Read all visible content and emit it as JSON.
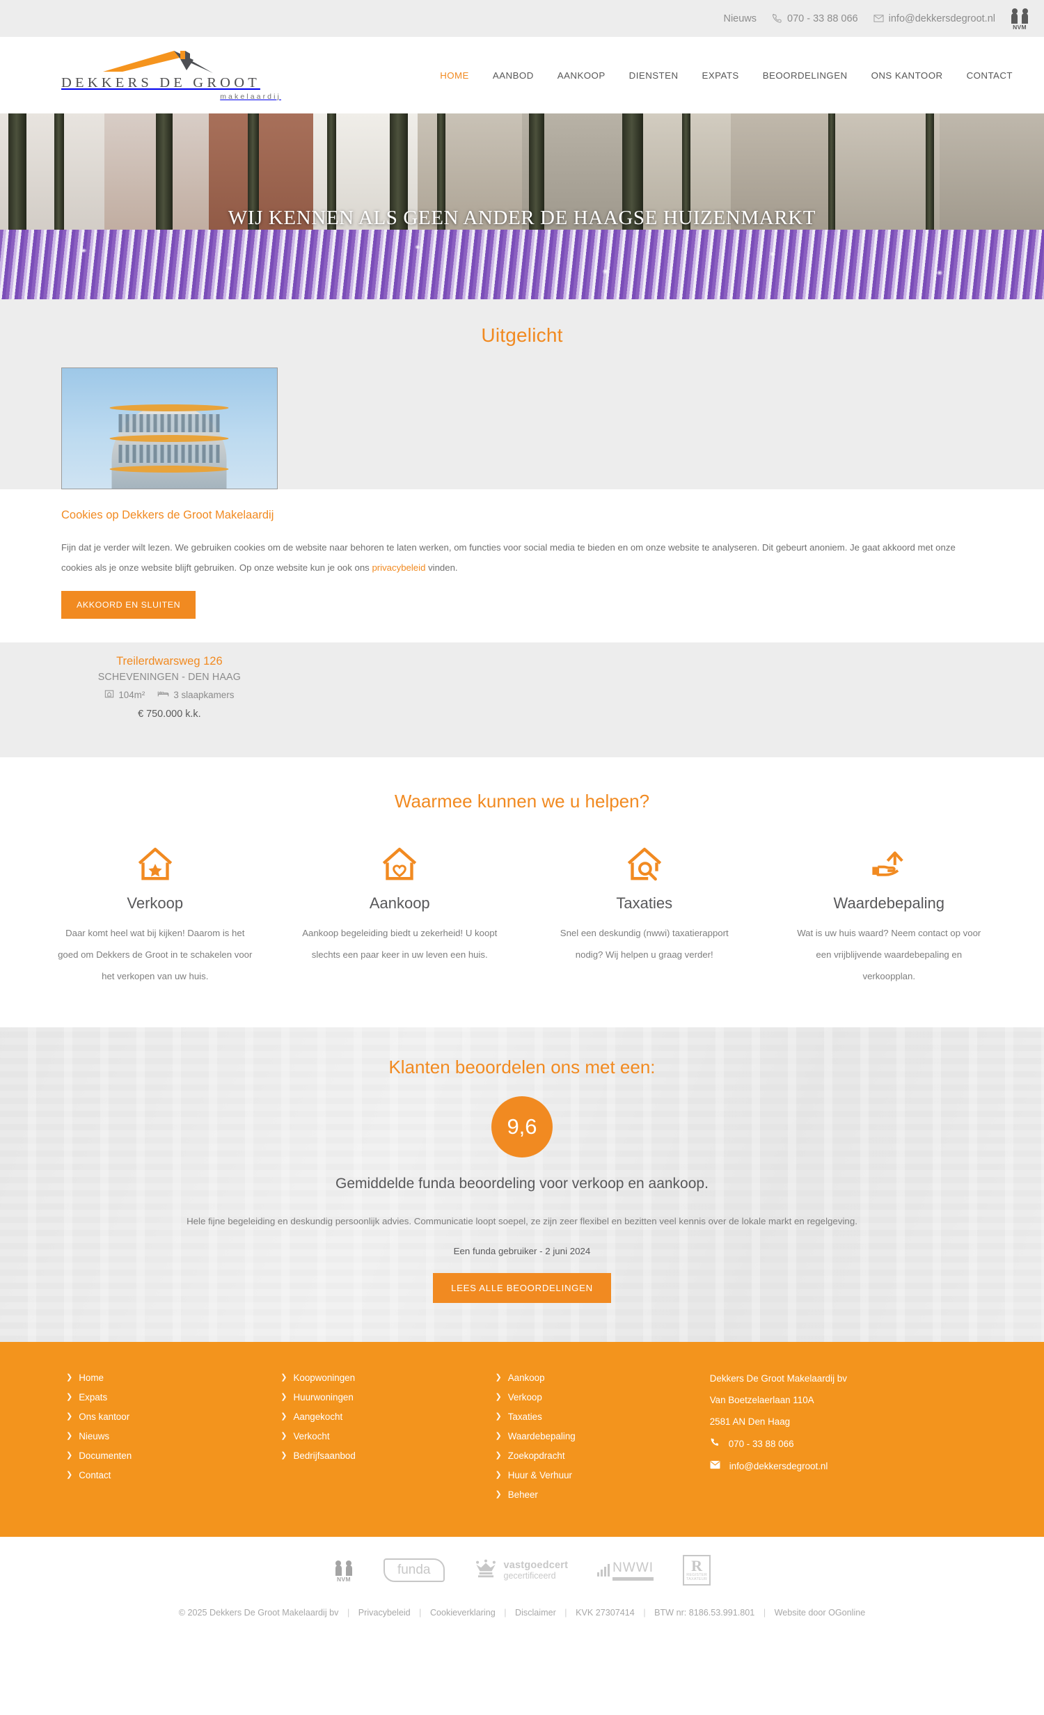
{
  "topbar": {
    "news_label": "Nieuws",
    "phone": "070 - 33 88 066",
    "email": "info@dekkersdegroot.nl",
    "nvm_label": "NVM"
  },
  "logo": {
    "name": "DEKKERS DE GROOT",
    "tagline": "makelaardij"
  },
  "nav": {
    "items": [
      {
        "label": "HOME",
        "active": true
      },
      {
        "label": "AANBOD",
        "active": false
      },
      {
        "label": "AANKOOP",
        "active": false
      },
      {
        "label": "DIENSTEN",
        "active": false
      },
      {
        "label": "EXPATS",
        "active": false
      },
      {
        "label": "BEOORDELINGEN",
        "active": false
      },
      {
        "label": "ONS KANTOOR",
        "active": false
      },
      {
        "label": "CONTACT",
        "active": false
      }
    ]
  },
  "hero": {
    "title": "WIJ KENNEN ALS GEEN ANDER DE HAAGSE HUIZENMARKT"
  },
  "featured": {
    "heading": "Uitgelicht"
  },
  "cookies": {
    "title": "Cookies op Dekkers de Groot Makelaardij",
    "body_part1": "Fijn dat je verder wilt lezen. We gebruiken cookies om de website naar behoren te laten werken, om functies voor social media te bieden en om onze website te analyseren. Dit gebeurt anoniem. Je gaat akkoord met onze cookies als je onze website blijft gebruiken. Op onze website kun je ook ons ",
    "link_label": "privacybeleid",
    "body_part2": " vinden.",
    "accept_label": "AKKOORD EN SLUITEN"
  },
  "property": {
    "street": "Treilerdwarsweg 126",
    "city": "SCHEVENINGEN - DEN HAAG",
    "area": "104m²",
    "bedrooms": "3 slaapkamers",
    "price": "€ 750.000 k.k."
  },
  "help": {
    "heading": "Waarmee kunnen we u helpen?",
    "cards": [
      {
        "icon": "house-star-icon",
        "title": "Verkoop",
        "text": "Daar komt heel wat bij kijken! Daarom is het goed om Dekkers de Groot in te schakelen voor het verkopen van uw huis."
      },
      {
        "icon": "house-heart-icon",
        "title": "Aankoop",
        "text": "Aankoop begeleiding biedt u zekerheid! U koopt slechts een paar keer in uw leven een huis."
      },
      {
        "icon": "house-search-icon",
        "title": "Taxaties",
        "text": "Snel een deskundig (nwwi) taxatierapport nodig? Wij helpen u graag verder!"
      },
      {
        "icon": "hand-house-up-icon",
        "title": "Waardebepaling",
        "text": "Wat is uw huis waard? Neem contact op voor een vrijblijvende waardebepaling en verkoopplan."
      }
    ]
  },
  "reviews": {
    "heading": "Klanten beoordelen ons met een:",
    "score": "9,6",
    "subtitle": "Gemiddelde funda beoordeling voor verkoop en aankoop.",
    "quote": "Hele fijne begeleiding en deskundig persoonlijk advies. Communicatie loopt soepel, ze zijn zeer flexibel en bezitten veel kennis over de lokale markt en regelgeving.",
    "author": "Een funda gebruiker - 2 juni 2024",
    "button_label": "LEES ALLE BEOORDELINGEN"
  },
  "footer": {
    "col1": [
      "Home",
      "Expats",
      "Ons kantoor",
      "Nieuws",
      "Documenten",
      "Contact"
    ],
    "col2": [
      "Koopwoningen",
      "Huurwoningen",
      "Aangekocht",
      "Verkocht",
      "Bedrijfsaanbod"
    ],
    "col3": [
      "Aankoop",
      "Verkoop",
      "Taxaties",
      "Waardebepaling",
      "Zoekopdracht",
      "Huur & Verhuur",
      "Beheer"
    ],
    "address": {
      "company": "Dekkers De Groot Makelaardij bv",
      "street": "Van Boetzelaerlaan 110A",
      "city": "2581 AN Den Haag",
      "phone": "070 - 33 88 066",
      "email": "info@dekkersdegroot.nl"
    }
  },
  "partners": {
    "nvm": "NVM",
    "funda": "funda",
    "vastgoedcert_line1": "vastgoedcert",
    "vastgoedcert_line2": "gecertificeerd",
    "nwwi": "NWWI",
    "register_letter": "R",
    "register_line1": "REGISTER",
    "register_line2": "TAXATEUR"
  },
  "bottom": {
    "copyright": "© 2025 Dekkers De Groot Makelaardij bv",
    "links": [
      "Privacybeleid",
      "Cookieverklaring",
      "Disclaimer",
      "KVK 27307414",
      "BTW nr: 8186.53.991.801",
      "Website door OGonline"
    ]
  },
  "colors": {
    "accent": "#f18a21",
    "footer": "#f3941d",
    "text": "#58585a",
    "muted": "#8b8b8b",
    "light_bg": "#ededed"
  }
}
